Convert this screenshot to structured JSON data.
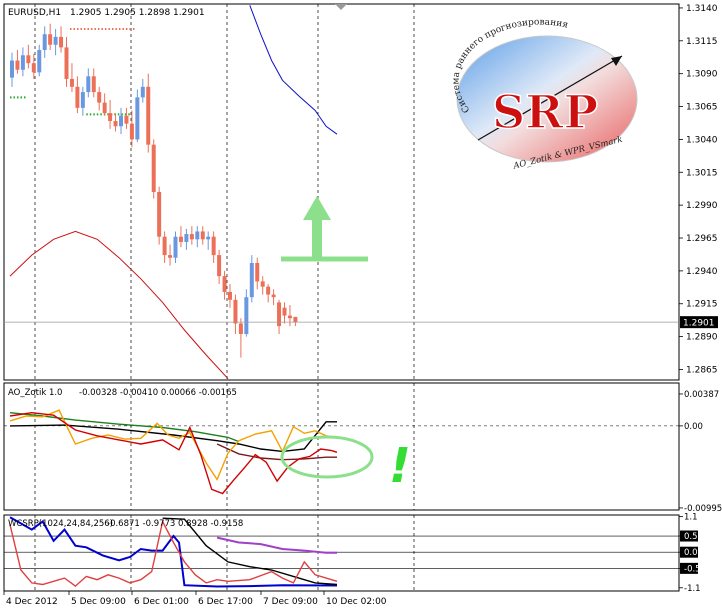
{
  "chart_data": [
    {
      "type": "candlestick",
      "title": "EURUSD,H1",
      "ohlc_label": "1.2905 1.2905 1.2898 1.2901",
      "ylim": [
        1.2857,
        1.3143
      ],
      "y_ticks": [
        "1.3140",
        "1.3115",
        "1.3090",
        "1.3065",
        "1.3040",
        "1.3015",
        "1.2990",
        "1.2965",
        "1.2940",
        "1.2915",
        "1.2890",
        "1.2865"
      ],
      "current_price": "1.2901",
      "x_ticks": [
        "4 Dec 2012",
        "5 Dec 09:00",
        "6 Dec 01:00",
        "6 Dec 17:00",
        "7 Dec 09:00",
        "10 Dec 02:00"
      ],
      "bull_color": "#6a98e0",
      "bear_color": "#ec7058",
      "bars": [
        [
          1.3087,
          1.3106,
          1.308,
          1.31
        ],
        [
          1.31,
          1.3108,
          1.309,
          1.3093
        ],
        [
          1.3093,
          1.311,
          1.3088,
          1.3104
        ],
        [
          1.3104,
          1.3112,
          1.3094,
          1.3098
        ],
        [
          1.3098,
          1.3105,
          1.3086,
          1.3091
        ],
        [
          1.3091,
          1.3112,
          1.3088,
          1.3108
        ],
        [
          1.3108,
          1.3126,
          1.3102,
          1.312
        ],
        [
          1.312,
          1.3128,
          1.3108,
          1.3112
        ],
        [
          1.3112,
          1.3124,
          1.3104,
          1.3118
        ],
        [
          1.3118,
          1.3126,
          1.3106,
          1.311
        ],
        [
          1.311,
          1.3118,
          1.308,
          1.3086
        ],
        [
          1.3086,
          1.3098,
          1.3076,
          1.308
        ],
        [
          1.308,
          1.3088,
          1.306,
          1.3064
        ],
        [
          1.3064,
          1.308,
          1.3058,
          1.3076
        ],
        [
          1.3076,
          1.3094,
          1.3072,
          1.3088
        ],
        [
          1.3088,
          1.3094,
          1.3072,
          1.3076
        ],
        [
          1.3076,
          1.308,
          1.3062,
          1.3068
        ],
        [
          1.3068,
          1.3075,
          1.3058,
          1.306
        ],
        [
          1.306,
          1.307,
          1.3048,
          1.3054
        ],
        [
          1.3054,
          1.306,
          1.3046,
          1.305
        ],
        [
          1.305,
          1.3064,
          1.3044,
          1.3058
        ],
        [
          1.3058,
          1.3064,
          1.3048,
          1.3052
        ],
        [
          1.3052,
          1.3062,
          1.3034,
          1.304
        ],
        [
          1.304,
          1.3078,
          1.3038,
          1.3072
        ],
        [
          1.3072,
          1.3086,
          1.3068,
          1.308
        ],
        [
          1.308,
          1.309,
          1.303,
          1.3036
        ],
        [
          1.3036,
          1.304,
          1.2995,
          1.3
        ],
        [
          1.3,
          1.3004,
          1.296,
          1.2966
        ],
        [
          1.2966,
          1.297,
          1.2946,
          1.2952
        ],
        [
          1.2952,
          1.296,
          1.2944,
          1.295
        ],
        [
          1.295,
          1.297,
          1.2946,
          1.2966
        ],
        [
          1.2966,
          1.2974,
          1.2958,
          1.2962
        ],
        [
          1.2962,
          1.2972,
          1.2956,
          1.2968
        ],
        [
          1.2968,
          1.2974,
          1.296,
          1.2964
        ],
        [
          1.2964,
          1.2974,
          1.2958,
          1.297
        ],
        [
          1.297,
          1.2974,
          1.296,
          1.2964
        ],
        [
          1.2964,
          1.297,
          1.2956,
          1.2966
        ],
        [
          1.2966,
          1.297,
          1.2946,
          1.2952
        ],
        [
          1.2952,
          1.2956,
          1.293,
          1.2936
        ],
        [
          1.2936,
          1.294,
          1.2918,
          1.2924
        ],
        [
          1.2924,
          1.293,
          1.2912,
          1.2918
        ],
        [
          1.2918,
          1.2922,
          1.2892,
          1.29
        ],
        [
          1.29,
          1.2904,
          1.2874,
          1.2892
        ],
        [
          1.2892,
          1.2926,
          1.289,
          1.292
        ],
        [
          1.292,
          1.2952,
          1.2916,
          1.2946
        ],
        [
          1.2946,
          1.295,
          1.2926,
          1.2932
        ],
        [
          1.2932,
          1.2936,
          1.2922,
          1.2928
        ],
        [
          1.2928,
          1.293,
          1.2916,
          1.2922
        ],
        [
          1.2922,
          1.2926,
          1.2914,
          1.292
        ],
        [
          1.2916,
          1.2918,
          1.2892,
          1.2898
        ],
        [
          1.2912,
          1.2916,
          1.29,
          1.2906
        ],
        [
          1.2906,
          1.2914,
          1.2898,
          1.2904
        ],
        [
          1.2905,
          1.2905,
          1.2898,
          1.2901
        ]
      ],
      "ma_blue": [
        [
          44,
          1.3142
        ],
        [
          46,
          1.312
        ],
        [
          48,
          1.31
        ],
        [
          50,
          1.3085
        ],
        [
          53,
          1.3073
        ],
        [
          56,
          1.3062
        ],
        [
          58,
          1.305
        ],
        [
          60,
          1.3044
        ]
      ],
      "ma_red": [
        [
          0,
          1.2936
        ],
        [
          4,
          1.2952
        ],
        [
          8,
          1.2964
        ],
        [
          12,
          1.297
        ],
        [
          16,
          1.2964
        ],
        [
          20,
          1.295
        ],
        [
          24,
          1.2934
        ],
        [
          28,
          1.2916
        ],
        [
          32,
          1.2895
        ],
        [
          36,
          1.2876
        ],
        [
          40,
          1.2858
        ]
      ],
      "levels_dotted_red": [
        [
          11,
          23,
          1.3124
        ]
      ],
      "levels_dotted_green": [
        [
          0,
          3,
          1.3072
        ],
        [
          14,
          22,
          1.3059
        ]
      ],
      "levels_dotted_black": [
        [
          52,
          64,
          1.295
        ]
      ]
    },
    {
      "type": "line",
      "title": "AO_Zotik 1.0",
      "values_label": "-0.00328 -0.00410 0.00066 -0.00165",
      "ylim": [
        -0.0102,
        0.0052
      ],
      "y_ticks": [
        "0.00387",
        "0.00",
        "-0.00995"
      ],
      "series": [
        {
          "color": "#000000",
          "values": [
            [
              0,
              0.0
            ],
            [
              10,
              0.0001
            ],
            [
              20,
              -0.0004
            ],
            [
              30,
              -0.0011
            ],
            [
              38,
              -0.0018
            ],
            [
              42,
              -0.0022
            ],
            [
              46,
              -0.0028
            ],
            [
              50,
              -0.0031
            ],
            [
              54,
              -0.0028
            ],
            [
              58,
              0.0005
            ],
            [
              60,
              0.0005
            ]
          ]
        },
        {
          "color": "#7a1a1a",
          "values": [
            [
              38,
              -0.0022
            ],
            [
              42,
              -0.0034
            ],
            [
              46,
              -0.0039
            ],
            [
              50,
              -0.0041
            ],
            [
              54,
              -0.004
            ],
            [
              58,
              -0.0038
            ],
            [
              60,
              -0.0038
            ]
          ]
        },
        {
          "color": "#1f7f1f",
          "values": [
            [
              0,
              0.0016
            ],
            [
              6,
              0.0012
            ],
            [
              12,
              0.0007
            ],
            [
              20,
              0.0002
            ],
            [
              28,
              -0.0002
            ],
            [
              34,
              -0.0007
            ],
            [
              40,
              -0.0014
            ],
            [
              42,
              -0.0019
            ]
          ]
        },
        {
          "color": "#f5a000",
          "values": [
            [
              0,
              0.0006
            ],
            [
              3,
              0.0012
            ],
            [
              6,
              0.0011
            ],
            [
              9,
              0.0019
            ],
            [
              12,
              -0.0022
            ],
            [
              15,
              -0.0015
            ],
            [
              18,
              -0.0011
            ],
            [
              21,
              -0.0016
            ],
            [
              24,
              -0.0015
            ],
            [
              27,
              0.0003
            ],
            [
              29,
              -0.0011
            ],
            [
              31,
              -0.0015
            ],
            [
              33,
              -0.0008
            ],
            [
              36,
              -0.0045
            ],
            [
              38,
              -0.0065
            ],
            [
              40,
              -0.0033
            ],
            [
              42,
              -0.0018
            ],
            [
              45,
              -0.001
            ],
            [
              48,
              -0.0006
            ],
            [
              50,
              -0.0031
            ],
            [
              52,
              -0.0001
            ],
            [
              54,
              -0.0009
            ],
            [
              56,
              -0.0006
            ],
            [
              58,
              -0.0012
            ],
            [
              60,
              -0.0014
            ]
          ]
        },
        {
          "color": "#d00000",
          "values": [
            [
              0,
              0.0012
            ],
            [
              4,
              0.0016
            ],
            [
              8,
              0.0013
            ],
            [
              12,
              -0.0005
            ],
            [
              16,
              -0.0012
            ],
            [
              20,
              -0.0017
            ],
            [
              24,
              -0.0022
            ],
            [
              28,
              -0.0017
            ],
            [
              31,
              -0.0029
            ],
            [
              33,
              -0.0002
            ],
            [
              35,
              -0.0035
            ],
            [
              37,
              -0.0077
            ],
            [
              39,
              -0.0082
            ],
            [
              41,
              -0.0066
            ],
            [
              43,
              -0.0051
            ],
            [
              45,
              -0.0035
            ],
            [
              47,
              -0.0044
            ],
            [
              49,
              -0.0067
            ],
            [
              51,
              -0.005
            ],
            [
              53,
              -0.004
            ],
            [
              55,
              -0.0037
            ],
            [
              57,
              -0.0028
            ],
            [
              59,
              -0.003
            ],
            [
              60,
              -0.0032
            ]
          ]
        }
      ]
    },
    {
      "type": "line",
      "title": "WCSRP(1024,24,84,256)",
      "values_label": "-0.6871 -0.9773 0.8928 -0.9158",
      "ylim": [
        -1.2,
        1.15
      ],
      "y_ticks": [
        "1.1",
        "0.5",
        "0.0",
        "-0.5",
        "-1.1"
      ],
      "highlight_ticks": [
        "0.5",
        "0.0",
        "-0.5"
      ],
      "series": [
        {
          "color": "#a040c8",
          "values": [
            [
              38,
              0.45
            ],
            [
              42,
              0.3
            ],
            [
              46,
              0.25
            ],
            [
              50,
              0.1
            ],
            [
              54,
              0.05
            ],
            [
              58,
              -0.02
            ],
            [
              60,
              -0.02
            ]
          ]
        },
        {
          "color": "#0000d0",
          "values": [
            [
              0,
              1.08
            ],
            [
              4,
              0.7
            ],
            [
              6,
              0.95
            ],
            [
              8,
              0.35
            ],
            [
              10,
              0.7
            ],
            [
              12,
              0.2
            ],
            [
              14,
              0.15
            ],
            [
              17,
              -0.1
            ],
            [
              20,
              -0.25
            ],
            [
              22,
              -0.15
            ],
            [
              24,
              0.1
            ],
            [
              26,
              0.05
            ],
            [
              28,
              0.05
            ],
            [
              30,
              0.5
            ],
            [
              31,
              0.3
            ],
            [
              32,
              -1.02
            ],
            [
              38,
              -1.06
            ],
            [
              44,
              -1.05
            ],
            [
              50,
              -1.02
            ],
            [
              60,
              -1.03
            ]
          ]
        },
        {
          "color": "#000000",
          "values": [
            [
              28,
              1.05
            ],
            [
              32,
              1.02
            ],
            [
              36,
              0.2
            ],
            [
              40,
              -0.3
            ],
            [
              44,
              -0.45
            ],
            [
              48,
              -0.55
            ],
            [
              52,
              -0.75
            ],
            [
              56,
              -0.95
            ],
            [
              60,
              -1.0
            ]
          ]
        },
        {
          "color": "#e04040",
          "values": [
            [
              0,
              0.85
            ],
            [
              2,
              -0.55
            ],
            [
              4,
              -0.95
            ],
            [
              6,
              -1.0
            ],
            [
              8,
              -0.9
            ],
            [
              10,
              -0.8
            ],
            [
              12,
              -1.05
            ],
            [
              14,
              -0.75
            ],
            [
              16,
              -0.85
            ],
            [
              18,
              -0.7
            ],
            [
              20,
              -0.8
            ],
            [
              22,
              -0.95
            ],
            [
              24,
              -0.85
            ],
            [
              26,
              -0.6
            ],
            [
              28,
              0.95
            ],
            [
              30,
              0.3
            ],
            [
              32,
              -0.3
            ],
            [
              34,
              -0.7
            ],
            [
              36,
              -0.95
            ],
            [
              38,
              -0.85
            ],
            [
              40,
              -0.9
            ],
            [
              44,
              -0.85
            ],
            [
              48,
              -0.6
            ],
            [
              50,
              -0.8
            ],
            [
              52,
              -0.95
            ],
            [
              54,
              -0.3
            ],
            [
              56,
              -0.7
            ],
            [
              60,
              -0.9
            ]
          ]
        }
      ]
    }
  ],
  "logo": {
    "letters": "SRP",
    "ring_text": "Система раннего прогнозирования",
    "caption": "AO_Zotik & WPR_VSmark"
  },
  "annotation": {
    "exclamation": "!"
  }
}
